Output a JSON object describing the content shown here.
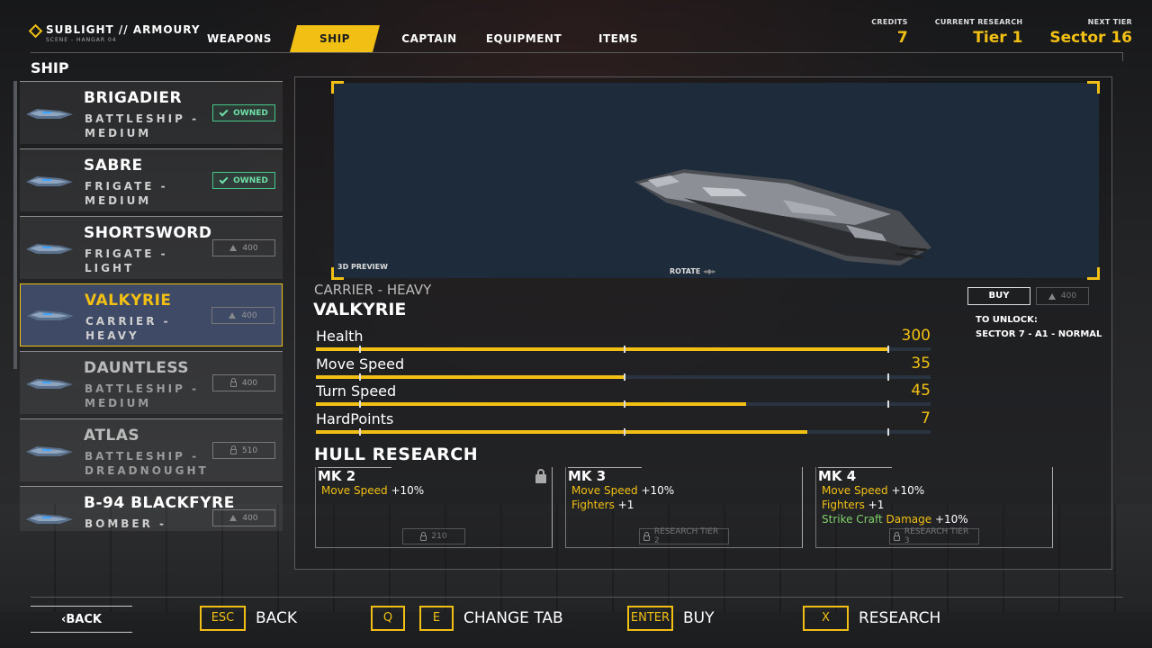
{
  "header": {
    "logo_title": "SUBLIGHT // ARMOURY",
    "logo_sub": "SCENE - HANGAR 04",
    "tabs": [
      {
        "label": "WEAPONS",
        "active": false
      },
      {
        "label": "SHIP",
        "active": true
      },
      {
        "label": "CAPTAIN",
        "active": false
      },
      {
        "label": "EQUIPMENT",
        "active": false
      },
      {
        "label": "ITEMS",
        "active": false
      }
    ],
    "credits_label": "CREDITS",
    "credits_value": "7",
    "research_label": "CURRENT RESEARCH",
    "research_value": "Tier 1",
    "next_label": "NEXT TIER",
    "next_value": "Sector 16",
    "accent": "#f2c014"
  },
  "ships_title": "SHIP",
  "ships": [
    {
      "name": "BRIGADIER",
      "cls": "BATTLESHIP - MEDIUM",
      "status": "owned",
      "badge": "OWNED",
      "icon": "battleship-thumb"
    },
    {
      "name": "SABRE",
      "cls": "FRIGATE - MEDIUM",
      "status": "owned",
      "badge": "OWNED",
      "icon": "frigate-thumb"
    },
    {
      "name": "SHORTSWORD",
      "cls": "FRIGATE - LIGHT",
      "status": "cost",
      "badge": "400",
      "icon": "frigate-thumb"
    },
    {
      "name": "VALKYRIE",
      "cls": "CARRIER - HEAVY",
      "status": "cost",
      "badge": "400",
      "icon": "carrier-thumb",
      "selected": true
    },
    {
      "name": "DAUNTLESS",
      "cls": "BATTLESHIP - MEDIUM",
      "status": "locked",
      "badge": "400",
      "icon": "battleship-thumb"
    },
    {
      "name": "ATLAS",
      "cls": "BATTLESHIP - DREADNOUGHT",
      "status": "locked",
      "badge": "510",
      "icon": "dreadnought-thumb"
    },
    {
      "name": "B-94 BLACKFYRE",
      "cls": "BOMBER -",
      "status": "cost",
      "badge": "400",
      "icon": "bomber-thumb"
    }
  ],
  "preview": {
    "label": "3D PREVIEW",
    "rotate": "ROTATE"
  },
  "detail": {
    "cls": "CARRIER - HEAVY",
    "name": "VALKYRIE",
    "stats": [
      {
        "label": "Health",
        "value": "300",
        "fill": 0.93
      },
      {
        "label": "Move Speed",
        "value": "35",
        "fill": 0.5
      },
      {
        "label": "Turn Speed",
        "value": "45",
        "fill": 0.7
      },
      {
        "label": "HardPoints",
        "value": "7",
        "fill": 0.8
      }
    ],
    "buy_label": "BUY",
    "buy_cost": "400",
    "unlock_title": "TO UNLOCK:",
    "unlock_req": "SECTOR 7 - A1 - NORMAL"
  },
  "hull": {
    "title": "HULL RESEARCH",
    "cards": [
      {
        "title": "MK 2",
        "lines": [
          [
            [
              "Move Speed",
              "y"
            ],
            [
              " +10%",
              "w"
            ]
          ]
        ],
        "foot": "210",
        "foot_icon": "lock",
        "locked": true
      },
      {
        "title": "MK 3",
        "lines": [
          [
            [
              "Move Speed",
              "y"
            ],
            [
              " +10%",
              "w"
            ]
          ],
          [
            [
              "Fighters",
              "y"
            ],
            [
              " +1",
              "w"
            ]
          ]
        ],
        "foot": "RESEARCH TIER 2",
        "foot_icon": "lock"
      },
      {
        "title": "MK 4",
        "lines": [
          [
            [
              "Move Speed",
              "y"
            ],
            [
              " +10%",
              "w"
            ]
          ],
          [
            [
              "Fighters",
              "y"
            ],
            [
              " +1",
              "w"
            ]
          ],
          [
            [
              "Strike Craft ",
              "g"
            ],
            [
              "Damage",
              "y"
            ],
            [
              " +10%",
              "w"
            ]
          ]
        ],
        "foot": "RESEARCH TIER 3",
        "foot_icon": "lock"
      }
    ]
  },
  "footer": {
    "back": "‹BACK",
    "esc_key": "ESC",
    "esc_label": "BACK",
    "q_key": "Q",
    "e_key": "E",
    "tab_label": "CHANGE TAB",
    "enter_key": "ENTER",
    "enter_label": "BUY",
    "x_key": "X",
    "x_label": "RESEARCH"
  }
}
